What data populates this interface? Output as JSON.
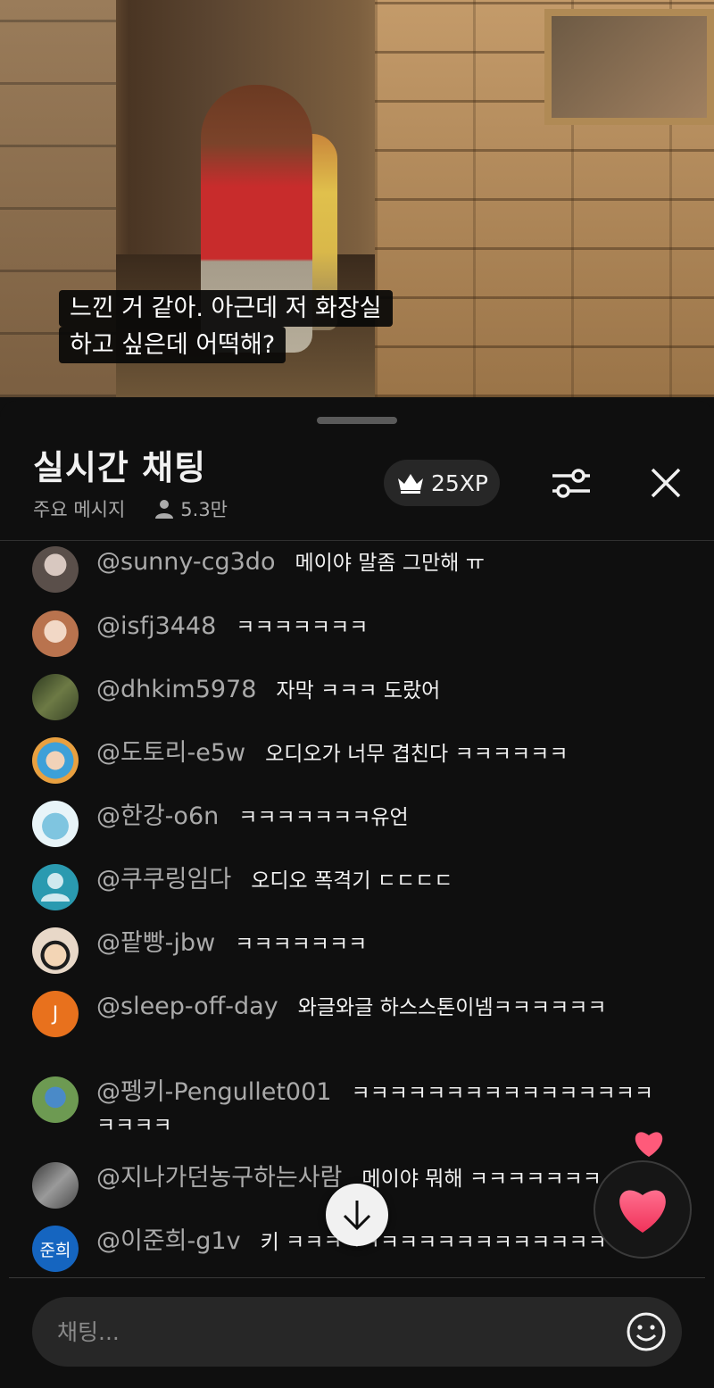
{
  "video": {
    "subtitle_lines": [
      "느낀 거 같아. 아근데 저 화장실",
      "하고 싶은데 어떡해?"
    ]
  },
  "chat": {
    "title": "실시간 채팅",
    "mode_label": "주요 메시지",
    "viewer_count": "5.3만",
    "xp_label": "25XP",
    "input_placeholder": "채팅...",
    "icons": {
      "crown": "crown-icon",
      "filter": "sliders-icon",
      "close": "close-icon",
      "person": "person-icon",
      "scroll": "arrow-down-icon",
      "heart": "heart-icon",
      "emoji": "emoji-icon"
    },
    "messages": [
      {
        "author": "@sunny-cg3do",
        "text": "메이야 말좀 그만해 ㅠ",
        "avatar_text": "",
        "avatar_color": "#6a5f5a"
      },
      {
        "author": "@isfj3448",
        "text": "ㅋㅋㅋㅋㅋㅋㅋ",
        "avatar_text": "",
        "avatar_color": "#b9734e"
      },
      {
        "author": "@dhkim5978",
        "text": "자막 ㅋㅋㅋ 도랐어",
        "avatar_text": "",
        "avatar_color": "#4d5a32"
      },
      {
        "author": "@도토리-e5w",
        "text": "오디오가 너무 겹친다 ㅋㅋㅋㅋㅋㅋ",
        "avatar_text": "",
        "avatar_color": "#4aa8d8"
      },
      {
        "author": "@한강-o6n",
        "text": "ㅋㅋㅋㅋㅋㅋㅋ유언",
        "avatar_text": "",
        "avatar_color": "#a9d7e8"
      },
      {
        "author": "@쿠쿠링임다",
        "text": "오디오 폭격기 ㄷㄷㄷㄷ",
        "avatar_text": "",
        "avatar_color": "#2a9ab0"
      },
      {
        "author": "@팥빵-jbw",
        "text": "ㅋㅋㅋㅋㅋㅋㅋ",
        "avatar_text": "",
        "avatar_color": "#e8d8c8"
      },
      {
        "author": "@sleep-off-day",
        "text": "와글와글 하스스톤이넴ㅋㅋㅋㅋㅋㅋ",
        "avatar_text": "J",
        "avatar_color": "#e8711d"
      },
      {
        "author": "@펭키-Pengullet001",
        "text": "ㅋㅋㅋㅋㅋㅋㅋㅋㅋㅋㅋㅋㅋㅋㅋㅋㅋㅋㅋㅋ",
        "avatar_text": "",
        "avatar_color": "#5a7a48"
      },
      {
        "author": "@지나가던농구하는사람",
        "text": "메이야 뭐해 ㅋㅋㅋㅋㅋㅋㅋ",
        "avatar_text": "",
        "avatar_color": "#7a7a7a"
      },
      {
        "author": "@이준희-g1v",
        "text": "키 ㅋㅋㅋㅋㅋㅋㅋㅋㅋㅋㅋㅋㅋㅋㅋㅋㅋ",
        "avatar_text": "준희",
        "avatar_color": "#1565c0"
      }
    ]
  }
}
